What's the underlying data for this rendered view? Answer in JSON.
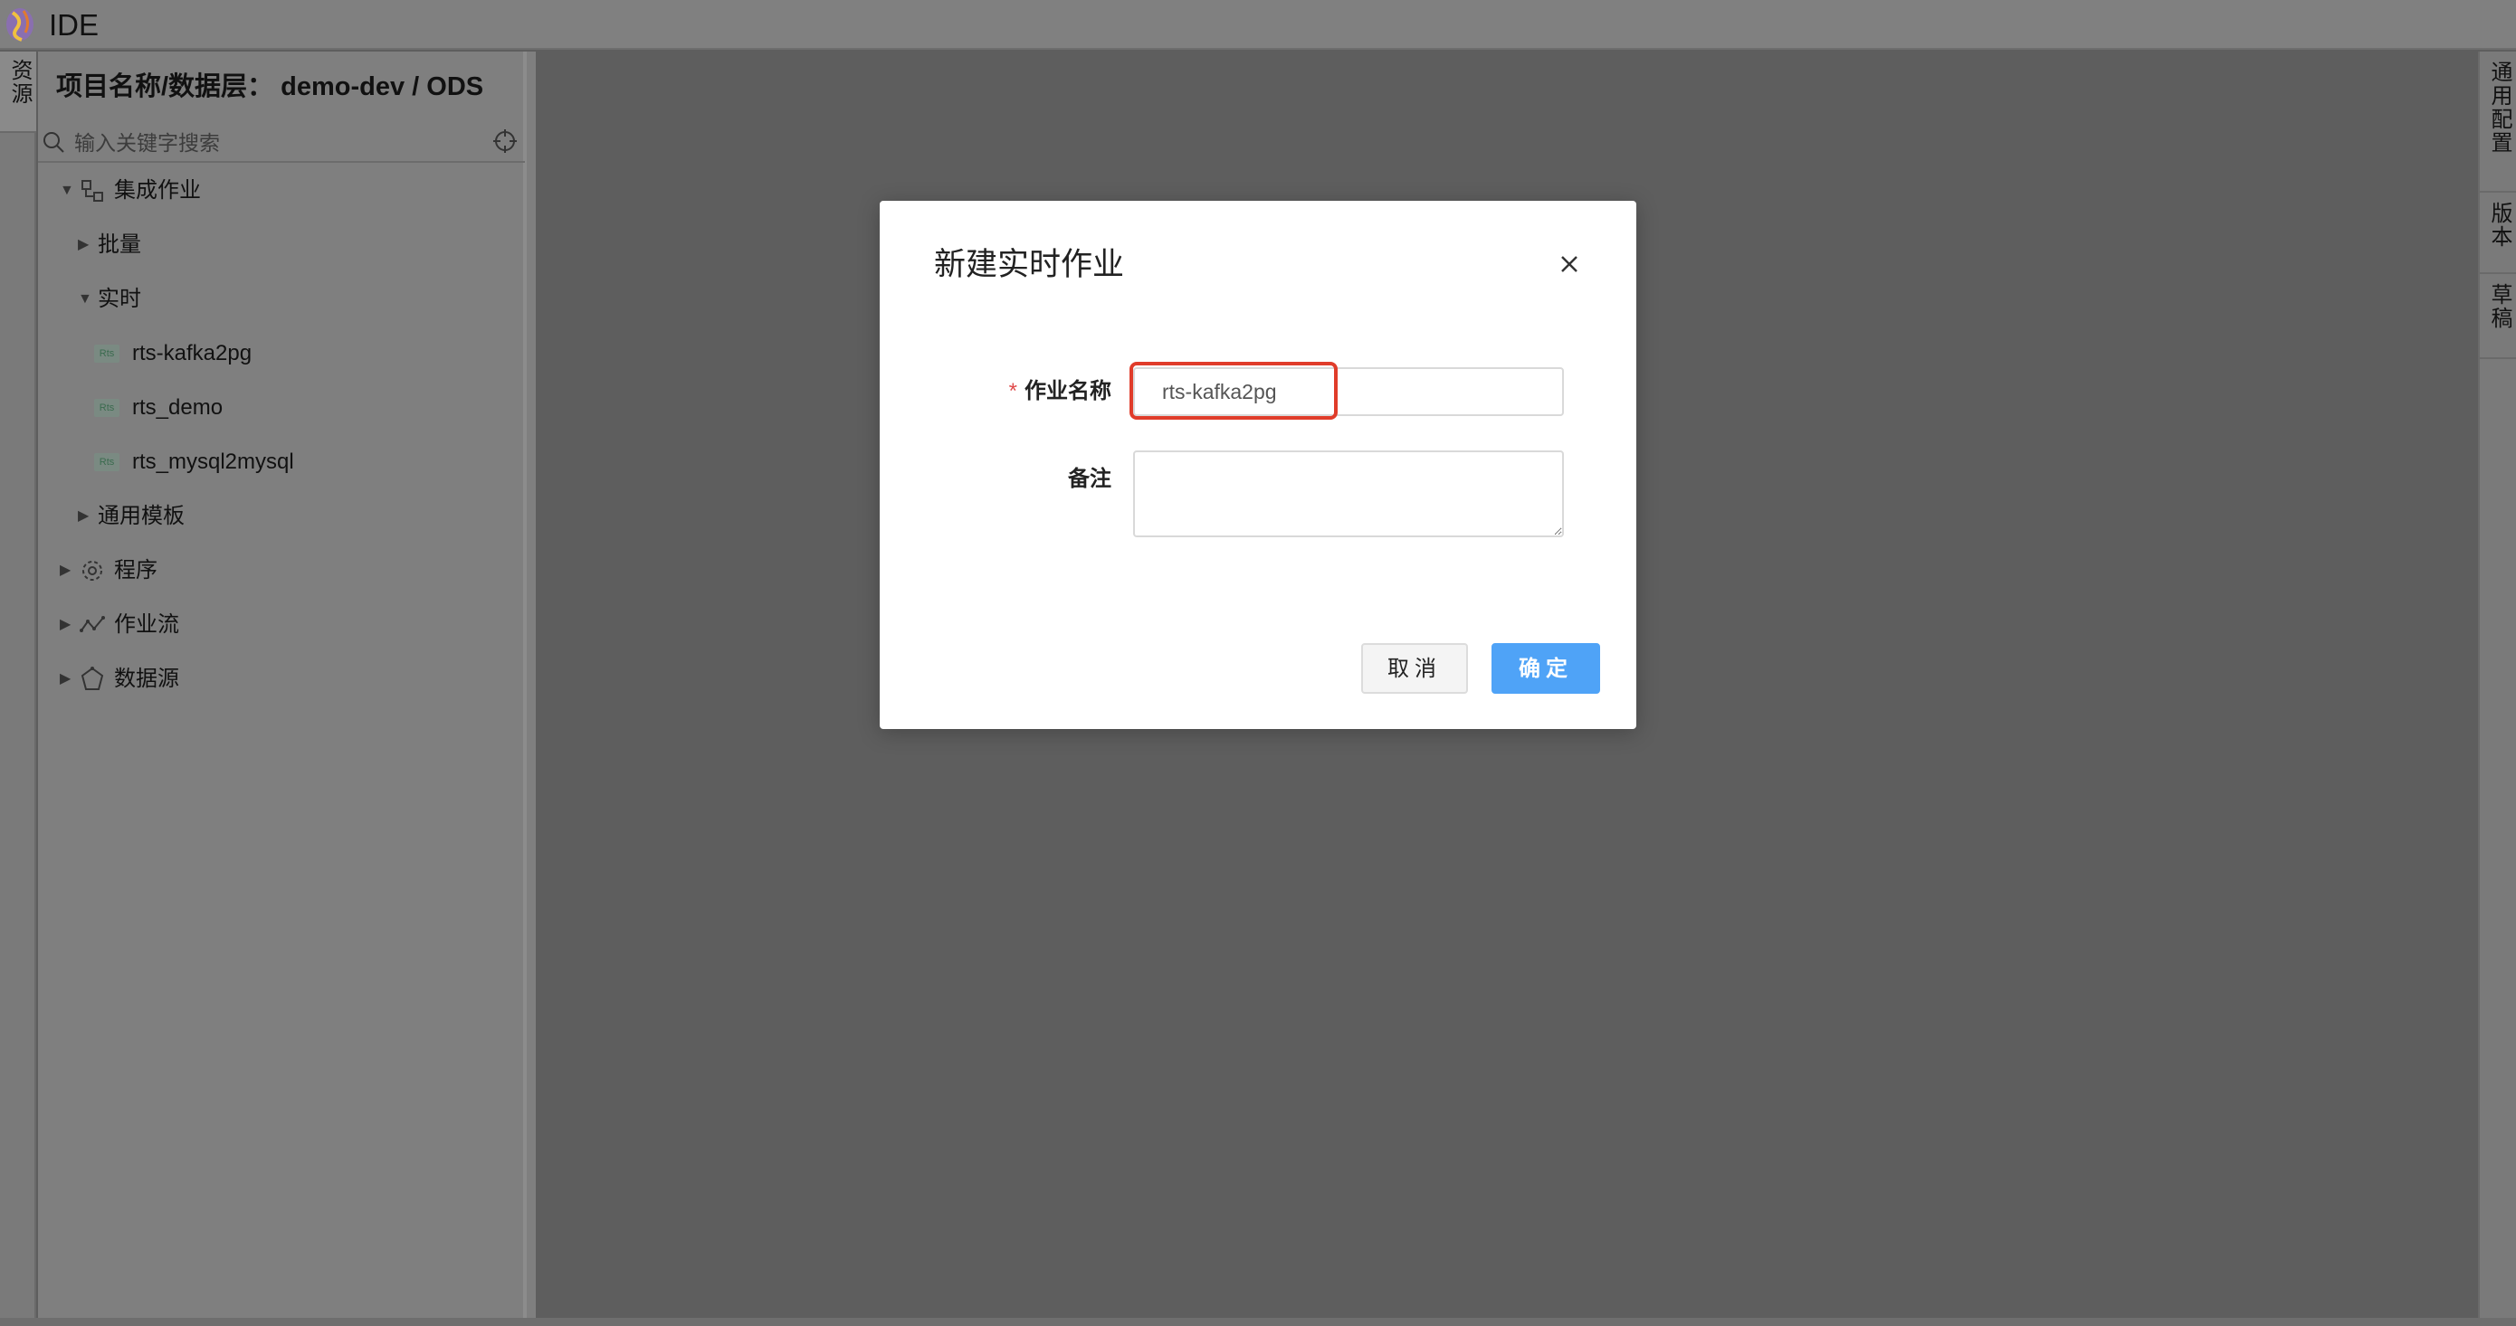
{
  "app": {
    "title": "IDE"
  },
  "left_strip": {
    "tab_label": "资源"
  },
  "sidebar": {
    "header": "项目名称/数据层：  demo-dev / ODS",
    "search_placeholder": "输入关键字搜索",
    "tree": {
      "integration_jobs": "集成作业",
      "batch": "批量",
      "realtime": "实时",
      "rts_badge": "Rts",
      "realtime_items": [
        "rts-kafka2pg",
        "rts_demo",
        "rts_mysql2mysql"
      ],
      "common_templates": "通用模板",
      "programs": "程序",
      "job_flows": "作业流",
      "data_sources": "数据源"
    }
  },
  "right_strip": {
    "tabs": [
      "通用配置",
      "版本",
      "草稿"
    ]
  },
  "dialog": {
    "title": "新建实时作业",
    "job_name_label": "作业名称",
    "job_name_value": "rts-kafka2pg",
    "required_mark": "*",
    "remark_label": "备注",
    "remark_value": "",
    "cancel_label": "取消",
    "ok_label": "确定"
  },
  "colors": {
    "primary": "#4fa3f7",
    "highlight": "#e03c2a",
    "required": "#e04b4b"
  }
}
